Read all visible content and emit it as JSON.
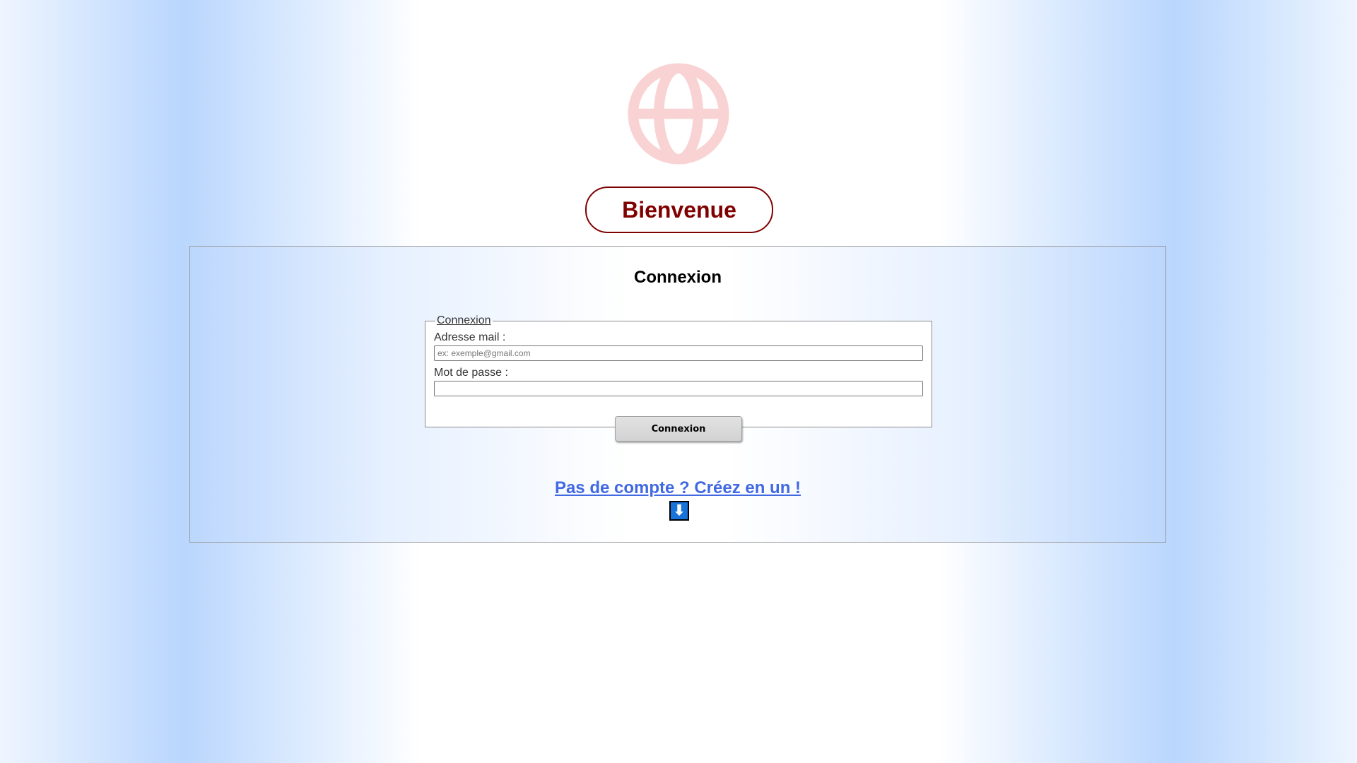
{
  "logo": {
    "icon": "globe-icon",
    "color": "#f9d3d3"
  },
  "welcome": {
    "text": "Bienvenue",
    "color": "#800000"
  },
  "panel": {
    "title": "Connexion",
    "form": {
      "legend": "Connexion",
      "email_label": "Adresse mail :",
      "email_placeholder": "ex: exemple@gmail.com",
      "email_value": "",
      "password_label": "Mot de passe :",
      "password_value": "",
      "submit_label": "Connexion"
    },
    "signup_link": "Pas de compte ? Créez en un !",
    "down_button": {
      "icon": "down-arrow-icon",
      "glyph": "⬇",
      "color": "#1a73d8"
    }
  }
}
